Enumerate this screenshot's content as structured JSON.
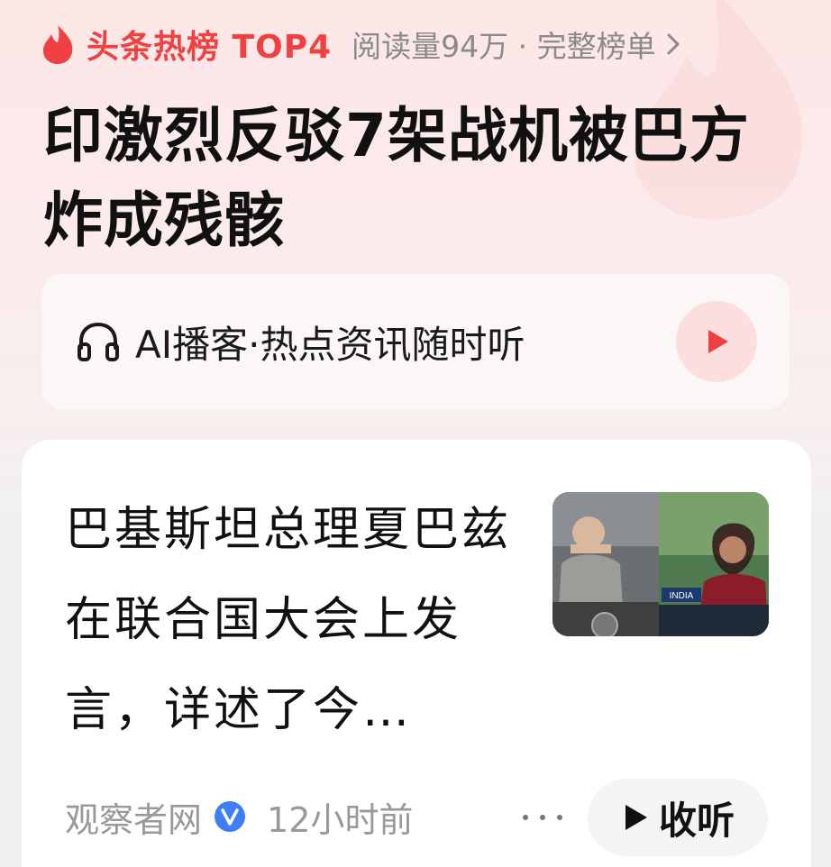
{
  "header": {
    "title": "头条热榜 TOP4",
    "meta": "阅读量94万 · 完整榜单",
    "icons": [
      "flame-icon",
      "chevron-right-icon"
    ],
    "accent": "#f04142"
  },
  "headline": "印激烈反驳7架战机被巴方炸成残骸",
  "podcast": {
    "label": "AI播客·热点资讯随时听",
    "icons": [
      "headphones-icon",
      "play-icon"
    ],
    "play_color": "#f04142"
  },
  "article": {
    "title": "巴基斯坦总理夏巴兹在联合国大会上发言，详述了今…",
    "thumbnail_caption": "INDIA",
    "source": "观察者网",
    "time": "12小时前",
    "listen_label": "收听",
    "icons": [
      "verified-icon",
      "more-icon",
      "play-icon"
    ],
    "verified_color": "#3f7ef5"
  }
}
